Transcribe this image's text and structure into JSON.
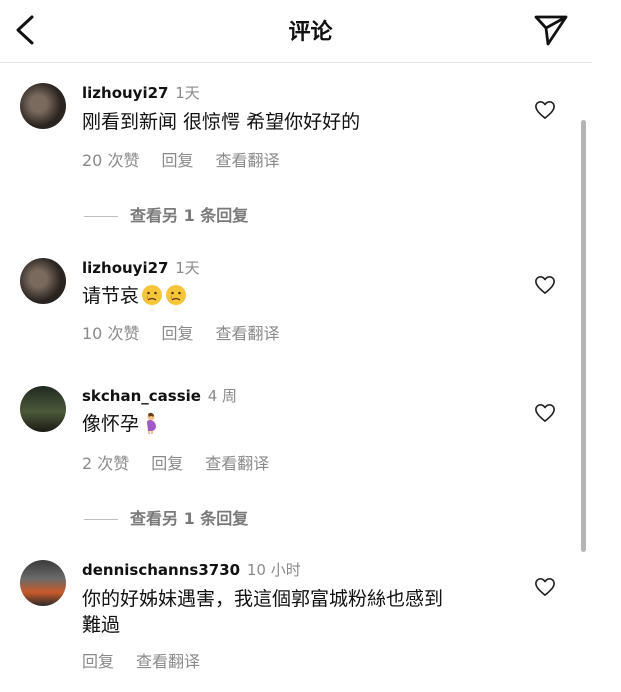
{
  "header": {
    "title": "评论"
  },
  "comments": [
    {
      "username": "lizhouyi27",
      "time": "1天",
      "text": "刚看到新闻 很惊愕 希望你好好的",
      "likes": "20 次赞",
      "reply": "回复",
      "translate": "查看翻译",
      "more_replies": "查看另 1 条回复",
      "avatar_colors": [
        "#2a2420",
        "#7a6a5e"
      ]
    },
    {
      "username": "lizhouyi27",
      "time": "1天",
      "text": "请节哀",
      "emoji": "crying-face-emoji",
      "likes": "10 次赞",
      "reply": "回复",
      "translate": "查看翻译",
      "avatar_colors": [
        "#2a2420",
        "#7a6a5e"
      ]
    },
    {
      "username": "skchan_cassie",
      "time": "4 周",
      "text": "像怀孕",
      "emoji": "pregnant-woman-emoji",
      "likes": "2 次赞",
      "reply": "回复",
      "translate": "查看翻译",
      "more_replies": "查看另 1 条回复",
      "avatar_colors": [
        "#1f2820",
        "#4d5a3a"
      ]
    },
    {
      "username": "dennischanns3730",
      "time": "10 小时",
      "text_line1": "你的好姊妹遇害，我這個郭富城粉絲也感到",
      "text_line2": "難過",
      "reply": "回复",
      "translate": "查看翻译",
      "avatar_colors": [
        "#3a3a3a",
        "#c85a2a"
      ]
    }
  ]
}
